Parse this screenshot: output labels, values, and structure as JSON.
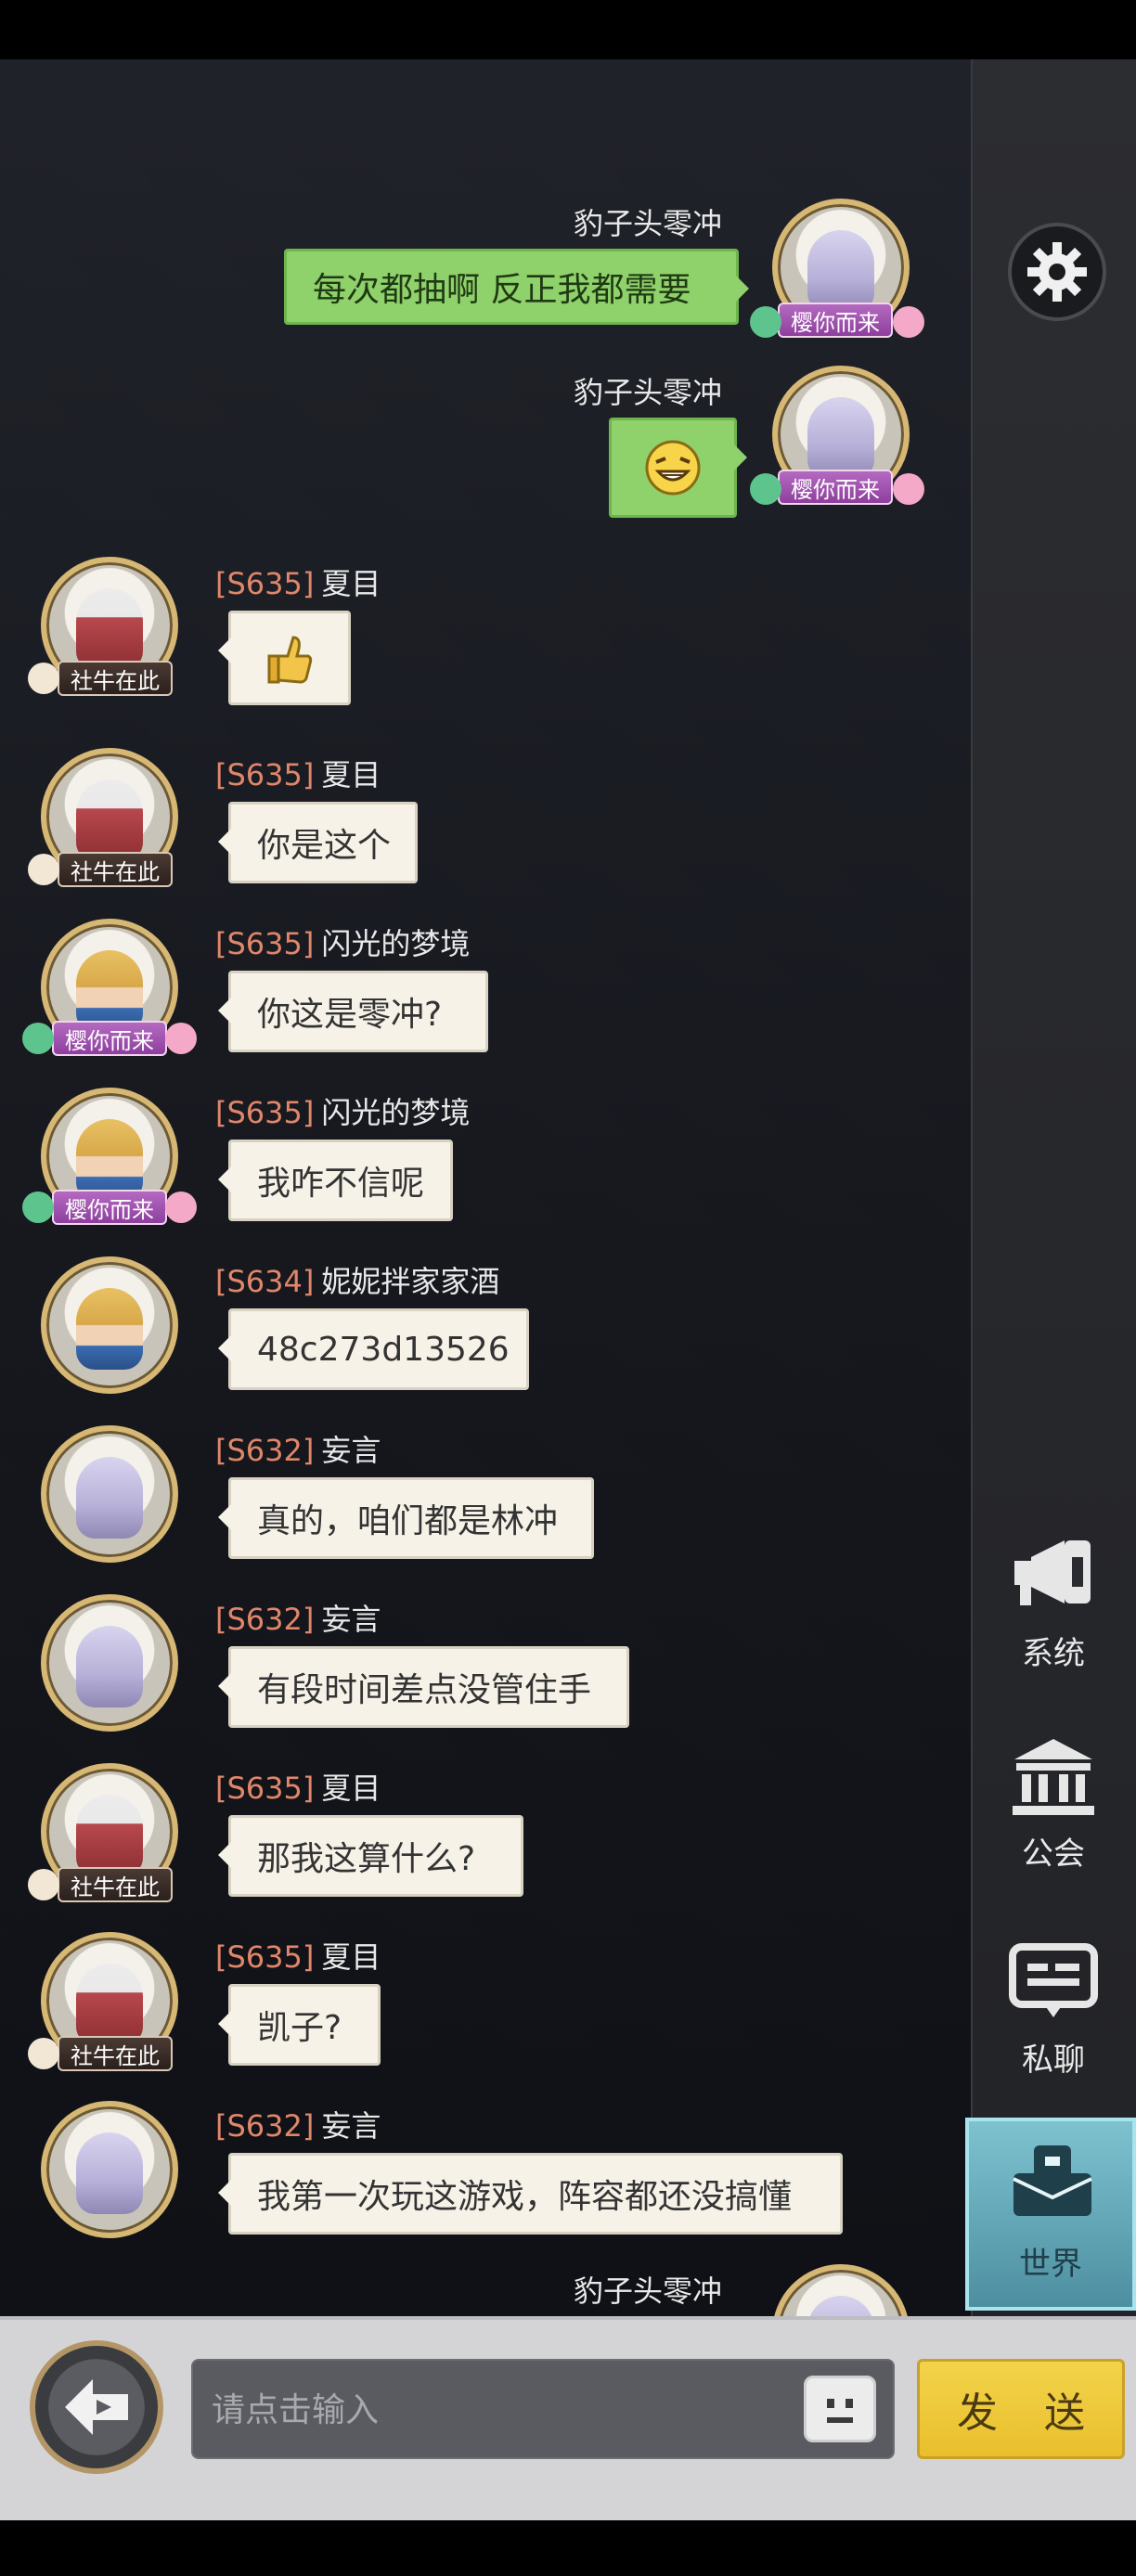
{
  "colors": {
    "server_tag": "#e0866a",
    "own_bubble": "#8fd16b",
    "other_bubble": "#f6f2e8",
    "send_button": "#f3d34a",
    "world_tab": "#6eb3c2"
  },
  "settings": {
    "icon": "gear-icon"
  },
  "side_tabs": {
    "system": {
      "label": "系统",
      "icon": "megaphone-icon"
    },
    "guild": {
      "label": "公会",
      "icon": "bank-icon"
    },
    "private": {
      "label": "私聊",
      "icon": "chat-bubble-icon"
    },
    "world": {
      "label": "世界",
      "icon": "world-chat-icon",
      "selected": true
    }
  },
  "messages": [
    {
      "side": "right",
      "name": "豹子头零冲",
      "text": "每次都抽啊 反正我都需要",
      "avatar": "silver",
      "tag": "樱你而来"
    },
    {
      "side": "right",
      "name": "豹子头零冲",
      "emoji": "grinning-emoji",
      "avatar": "silver",
      "tag": "樱你而来"
    },
    {
      "side": "left",
      "server": "[S635]",
      "name": "夏目",
      "emoji": "thumbs-up-emoji",
      "avatar": "red",
      "tag": "社牛在此"
    },
    {
      "side": "left",
      "server": "[S635]",
      "name": "夏目",
      "text": "你是这个",
      "avatar": "red",
      "tag": "社牛在此"
    },
    {
      "side": "left",
      "server": "[S635]",
      "name": "闪光的梦境",
      "text": "你这是零冲?",
      "avatar": "blond",
      "tag": "樱你而来"
    },
    {
      "side": "left",
      "server": "[S635]",
      "name": "闪光的梦境",
      "text": "我咋不信呢",
      "avatar": "blond",
      "tag": "樱你而来"
    },
    {
      "side": "left",
      "server": "[S634]",
      "name": "妮妮拌家家酒",
      "text": "48c273d13526",
      "avatar": "blond",
      "tag": ""
    },
    {
      "side": "left",
      "server": "[S632]",
      "name": "妄言",
      "text": "真的，咱们都是林冲",
      "avatar": "silver",
      "tag": ""
    },
    {
      "side": "left",
      "server": "[S632]",
      "name": "妄言",
      "text": "有段时间差点没管住手",
      "avatar": "silver",
      "tag": ""
    },
    {
      "side": "left",
      "server": "[S635]",
      "name": "夏目",
      "text": "那我这算什么?",
      "avatar": "red",
      "tag": "社牛在此"
    },
    {
      "side": "left",
      "server": "[S635]",
      "name": "夏目",
      "text": "凯子?",
      "avatar": "red",
      "tag": "社牛在此"
    },
    {
      "side": "left",
      "server": "[S632]",
      "name": "妄言",
      "text": "我第一次玩这游戏，阵容都还没搞懂",
      "avatar": "silver",
      "tag": ""
    },
    {
      "side": "right",
      "name": "豹子头零冲",
      "text": "",
      "avatar": "silver",
      "tag": ""
    }
  ],
  "input_bar": {
    "back_icon": "back-arrow-icon",
    "placeholder": "请点击输入",
    "emoji_icon": "face-emoji-icon",
    "send_label": "发 送"
  }
}
